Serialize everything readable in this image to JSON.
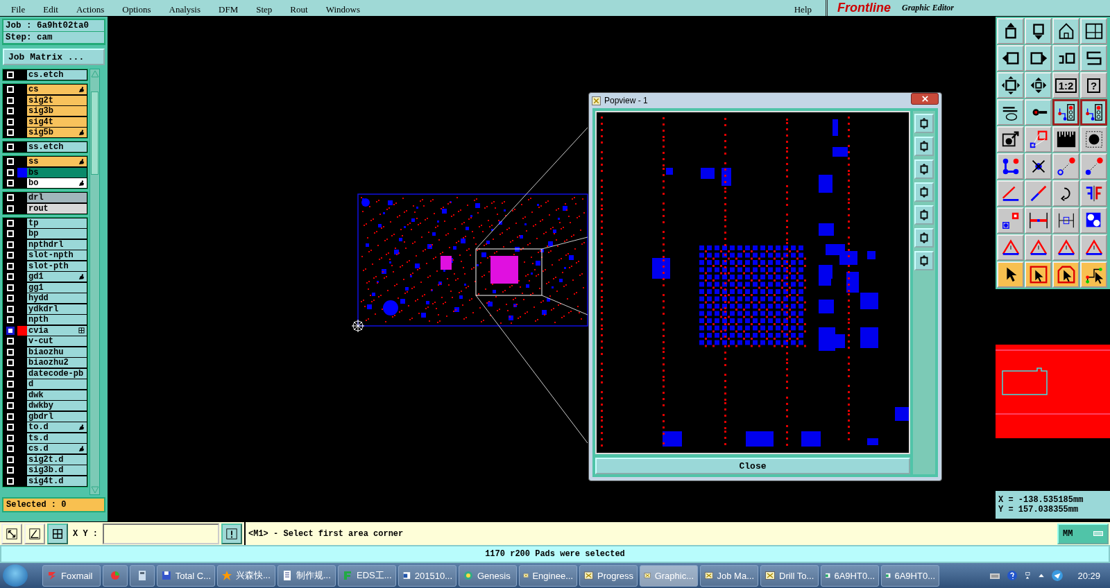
{
  "menu": [
    {
      "label": "File"
    },
    {
      "label": "Edit"
    },
    {
      "label": "Actions"
    },
    {
      "label": "Options"
    },
    {
      "label": "Analysis"
    },
    {
      "label": "DFM"
    },
    {
      "label": "Step"
    },
    {
      "label": "Rout"
    },
    {
      "label": "Windows"
    }
  ],
  "help_menu": "Help",
  "brand": {
    "logo": "Frontline",
    "subtitle": "Graphic Editor"
  },
  "job": {
    "job": "Job : 6a9ht02ta0",
    "step": "Step: cam",
    "matrix_button": "Job Matrix ..."
  },
  "layer_groups": [
    [
      {
        "name": "cs.etch",
        "kind": "misc",
        "marked": false,
        "grid": false,
        "selected": false
      }
    ],
    [
      {
        "name": "cs",
        "kind": "signal",
        "marked": true,
        "grid": false,
        "selected": false
      },
      {
        "name": "sig2t",
        "kind": "signal",
        "marked": false,
        "grid": false,
        "selected": false
      },
      {
        "name": "sig3b",
        "kind": "signal",
        "marked": false,
        "grid": false,
        "selected": false
      },
      {
        "name": "sig4t",
        "kind": "signal",
        "marked": false,
        "grid": false,
        "selected": false
      },
      {
        "name": "sig5b",
        "kind": "signal",
        "marked": true,
        "grid": false,
        "selected": false
      }
    ],
    [
      {
        "name": "ss.etch",
        "kind": "misc",
        "marked": false,
        "grid": false,
        "selected": false
      }
    ],
    [
      {
        "name": "ss",
        "kind": "signal",
        "marked": true,
        "grid": false,
        "selected": false
      },
      {
        "name": "bs",
        "kind": "mask",
        "color": "#0000ff",
        "marked": false,
        "grid": false,
        "selected": false
      },
      {
        "name": "bo",
        "kind": "board",
        "marked": true,
        "grid": false,
        "selected": false
      }
    ],
    [
      {
        "name": "drl",
        "kind": "drill",
        "marked": false,
        "grid": false,
        "selected": false
      },
      {
        "name": "rout",
        "kind": "rout",
        "marked": false,
        "grid": false,
        "selected": false
      }
    ],
    [
      {
        "name": "tp",
        "kind": "misc",
        "marked": false,
        "grid": false,
        "selected": false
      },
      {
        "name": "bp",
        "kind": "misc",
        "marked": false,
        "grid": false,
        "selected": false
      },
      {
        "name": "npthdrl",
        "kind": "misc",
        "marked": false,
        "grid": false,
        "selected": false
      },
      {
        "name": "slot-npth",
        "kind": "misc",
        "marked": false,
        "grid": false,
        "selected": false
      },
      {
        "name": "slot-pth",
        "kind": "misc",
        "marked": false,
        "grid": false,
        "selected": false
      },
      {
        "name": "gd1",
        "kind": "misc",
        "marked": true,
        "grid": false,
        "selected": false
      },
      {
        "name": "gg1",
        "kind": "misc",
        "marked": false,
        "grid": false,
        "selected": false
      },
      {
        "name": "hydd",
        "kind": "misc",
        "marked": false,
        "grid": false,
        "selected": false
      },
      {
        "name": "ydkdrl",
        "kind": "misc",
        "marked": false,
        "grid": false,
        "selected": false
      },
      {
        "name": "npth",
        "kind": "misc",
        "marked": false,
        "grid": false,
        "selected": false
      },
      {
        "name": "cvia",
        "kind": "misc",
        "color": "#ff0000",
        "marked": false,
        "grid": true,
        "selected": true
      },
      {
        "name": "v-cut",
        "kind": "misc",
        "marked": false,
        "grid": false,
        "selected": false
      },
      {
        "name": "biaozhu",
        "kind": "misc",
        "marked": false,
        "grid": false,
        "selected": false
      },
      {
        "name": "biaozhu2",
        "kind": "misc",
        "marked": false,
        "grid": false,
        "selected": false
      },
      {
        "name": "datecode-pb",
        "kind": "misc",
        "marked": false,
        "grid": false,
        "selected": false
      },
      {
        "name": "d",
        "kind": "misc",
        "marked": false,
        "grid": false,
        "selected": false
      },
      {
        "name": "dwk",
        "kind": "misc",
        "marked": false,
        "grid": false,
        "selected": false
      },
      {
        "name": "dwkby",
        "kind": "misc",
        "marked": false,
        "grid": false,
        "selected": false
      },
      {
        "name": "gbdrl",
        "kind": "misc",
        "marked": false,
        "grid": false,
        "selected": false
      },
      {
        "name": "to.d",
        "kind": "misc",
        "marked": true,
        "grid": false,
        "selected": false
      },
      {
        "name": "ts.d",
        "kind": "misc",
        "marked": false,
        "grid": false,
        "selected": false
      },
      {
        "name": "cs.d",
        "kind": "misc",
        "marked": true,
        "grid": false,
        "selected": false
      },
      {
        "name": "sig2t.d",
        "kind": "misc",
        "marked": false,
        "grid": false,
        "selected": false
      },
      {
        "name": "sig3b.d",
        "kind": "misc",
        "marked": false,
        "grid": false,
        "selected": false
      },
      {
        "name": "sig4t.d",
        "kind": "misc",
        "marked": false,
        "grid": false,
        "selected": false
      }
    ]
  ],
  "selected_count": "Selected : 0",
  "popup": {
    "title": "Popview - 1",
    "close_button": "Close"
  },
  "toolbar": [
    {
      "kind": "up"
    },
    {
      "kind": "down"
    },
    {
      "kind": "home"
    },
    {
      "kind": "grid"
    },
    {
      "kind": "left"
    },
    {
      "kind": "right"
    },
    {
      "kind": "undo"
    },
    {
      "kind": "snake"
    },
    {
      "kind": "fit"
    },
    {
      "kind": "pan"
    },
    {
      "kind": "text",
      "label": "1:2"
    },
    {
      "kind": "text",
      "label": "?"
    },
    {
      "kind": "tools"
    },
    {
      "kind": "probe"
    },
    {
      "kind": "net"
    },
    {
      "kind": "net"
    },
    {
      "kind": "padarrow"
    },
    {
      "kind": "measure"
    },
    {
      "kind": "ruler"
    },
    {
      "kind": "paddot"
    },
    {
      "kind": "nodes"
    },
    {
      "kind": "cross"
    },
    {
      "kind": "linkopen"
    },
    {
      "kind": "link"
    },
    {
      "kind": "angle"
    },
    {
      "kind": "split"
    },
    {
      "kind": "rotate"
    },
    {
      "kind": "mirror"
    },
    {
      "kind": "padsq"
    },
    {
      "kind": "mid"
    },
    {
      "kind": "dim"
    },
    {
      "kind": "shapes"
    },
    {
      "kind": "tri"
    },
    {
      "kind": "tri"
    },
    {
      "kind": "tri"
    },
    {
      "kind": "tri"
    },
    {
      "kind": "select"
    },
    {
      "kind": "selectbox"
    },
    {
      "kind": "selectpoly"
    },
    {
      "kind": "selectnet"
    }
  ],
  "coordinates": {
    "x": "X = -138.535185mm",
    "y": "Y = 157.038355mm"
  },
  "command_bar": {
    "xy_label": "X Y :",
    "prompt": "<M1> - Select first area corner",
    "units": "MM"
  },
  "status": "1170 r200 Pads were selected",
  "taskbar": {
    "items": [
      {
        "label": "Foxmail",
        "kind": "mail",
        "selected": false
      },
      {
        "kind": "chart",
        "selected": false
      },
      {
        "kind": "calc",
        "selected": false
      },
      {
        "label": "Total C...",
        "kind": "disk",
        "selected": false
      },
      {
        "label": "兴森快...",
        "kind": "star",
        "selected": false
      },
      {
        "label": "制作规...",
        "kind": "list",
        "selected": false
      },
      {
        "label": "EDS工...",
        "kind": "eds",
        "selected": false
      },
      {
        "label": "201510...",
        "kind": "word",
        "selected": false
      },
      {
        "label": "Genesis",
        "kind": "genesis",
        "selected": false
      },
      {
        "label": "Enginee...",
        "kind": "window",
        "selected": false
      },
      {
        "label": "Progress",
        "kind": "window",
        "selected": false
      },
      {
        "label": "Graphic...",
        "kind": "window",
        "selected": true
      },
      {
        "label": "Job Ma...",
        "kind": "window",
        "selected": false
      },
      {
        "label": "Drill To...",
        "kind": "window",
        "selected": false
      },
      {
        "label": "6A9HT0...",
        "kind": "excel",
        "selected": false
      },
      {
        "label": "6A9HT0...",
        "kind": "excel",
        "selected": false
      }
    ],
    "clock": "20:29"
  }
}
